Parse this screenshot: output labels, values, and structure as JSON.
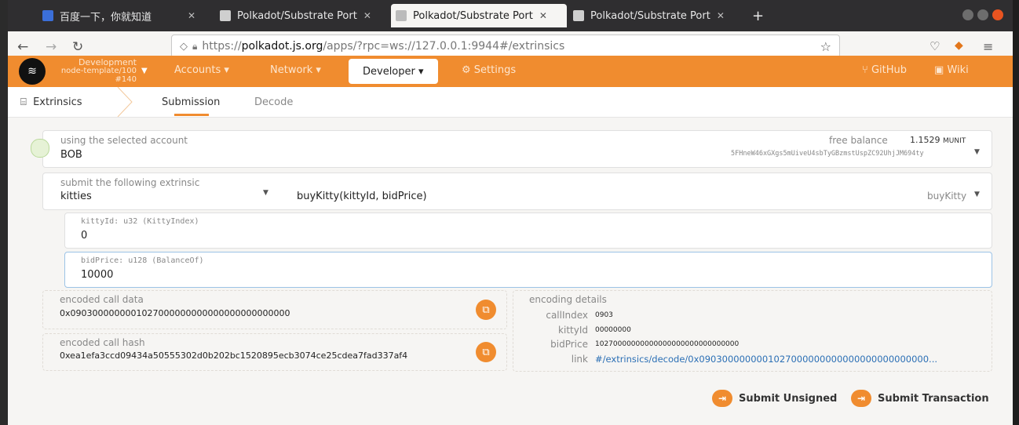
{
  "browser": {
    "tabs": [
      {
        "label": "百度一下，你就知道",
        "active": false
      },
      {
        "label": "Polkadot/Substrate Port",
        "active": false
      },
      {
        "label": "Polkadot/Substrate Port",
        "active": true
      },
      {
        "label": "Polkadot/Substrate Port",
        "active": false
      }
    ],
    "url_prefix": "https://",
    "url_host": "polkadot.js.org",
    "url_path": "/apps/?rpc=ws://127.0.0.1:9944#/extrinsics"
  },
  "app": {
    "chain_name": "Development",
    "chain_version": "node-template/100",
    "chain_block": "#140",
    "nav": {
      "accounts": "Accounts",
      "network": "Network",
      "developer": "Developer",
      "settings": "Settings",
      "github": "GitHub",
      "wiki": "Wiki"
    },
    "subnav": {
      "section": "Extrinsics",
      "tab_submission": "Submission",
      "tab_decode": "Decode"
    }
  },
  "account": {
    "label": "using the selected account",
    "name": "BOB",
    "balance_label": "free balance",
    "balance_value": "1.1529",
    "balance_unit": "MUNIT",
    "address": "5FHneW46xGXgs5mUiveU4sbTyGBzmstUspZC92UhjJM694ty"
  },
  "extrinsic": {
    "label": "submit the following extrinsic",
    "module": "kitties",
    "call": "buyKitty(kittyId, bidPrice)",
    "method": "buyKitty"
  },
  "params": {
    "kitty_label": "kittyId: u32 (KittyIndex)",
    "kitty_value": "0",
    "bid_label": "bidPrice: u128 (BalanceOf)",
    "bid_value": "10000"
  },
  "encoded": {
    "call_data_label": "encoded call data",
    "call_data": "0x0903000000001027000000000000000000000000",
    "call_hash_label": "encoded call hash",
    "call_hash": "0xea1efa3ccd09434a50555302d0b202bc1520895ecb3074ce25cdea7fad337af4"
  },
  "details": {
    "label": "encoding details",
    "call_index_key": "callIndex",
    "call_index": "0903",
    "kitty_key": "kittyId",
    "kitty": "00000000",
    "bid_key": "bidPrice",
    "bid": "10270000000000000000000000000000",
    "link_key": "link",
    "link": "#/extrinsics/decode/0x0903000000001027000000000000000000000000..."
  },
  "actions": {
    "submit_unsigned": "Submit Unsigned",
    "submit_transaction": "Submit Transaction"
  },
  "colors": {
    "accent": "#f08c2f"
  }
}
